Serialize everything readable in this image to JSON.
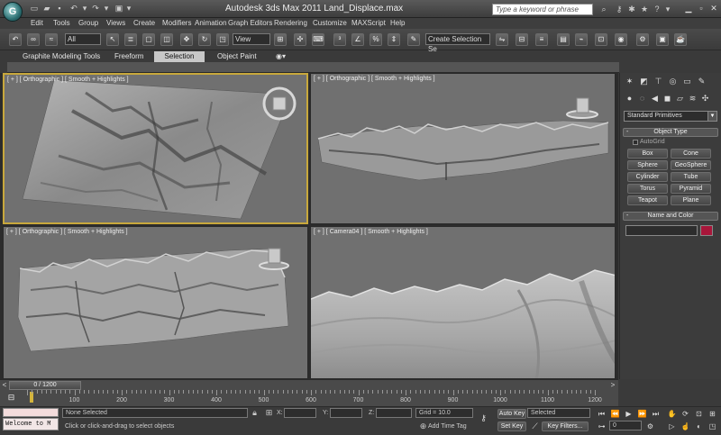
{
  "titlebar": {
    "app_title": "Autodesk 3ds Max  2011        Land_Displace.max",
    "search_placeholder": "Type a keyword or phrase",
    "logo_glyph": "G"
  },
  "menu": [
    "Edit",
    "Tools",
    "Group",
    "Views",
    "Create",
    "Modifiers",
    "Animation",
    "Graph Editors",
    "Rendering",
    "Customize",
    "MAXScript",
    "Help"
  ],
  "toolbar": {
    "filter_value": "All",
    "refcoord_value": "View",
    "selection_set_placeholder": "Create Selection Se"
  },
  "ribbon": {
    "tabs": [
      "Graphite Modeling Tools",
      "Freeform",
      "Selection",
      "Object Paint"
    ],
    "active_tab": "Selection"
  },
  "viewports": [
    {
      "label": "[ + ] [ Orthographic ] [ Smooth + Highlights ]",
      "active": true
    },
    {
      "label": "[ + ] [ Orthographic ] [ Smooth + Highlights ]",
      "active": false
    },
    {
      "label": "[ + ] [ Orthographic ] [ Smooth + Highlights ]",
      "active": false
    },
    {
      "label": "[ + ] [ Camera04 ] [ Smooth + Highlights ]",
      "active": false
    }
  ],
  "command_panel": {
    "category_dropdown": "Standard Primitives",
    "object_type_title": "Object Type",
    "autogrid_label": "AutoGrid",
    "primitives": [
      "Box",
      "Cone",
      "Sphere",
      "GeoSphere",
      "Cylinder",
      "Tube",
      "Torus",
      "Pyramid",
      "Teapot",
      "Plane"
    ],
    "name_color_title": "Name and Color",
    "object_color": "#a8163a"
  },
  "timeline": {
    "frame_display": "0 / 1200",
    "ruler_labels": [
      "100",
      "200",
      "300",
      "400",
      "500",
      "600",
      "700",
      "800",
      "900",
      "1000",
      "1100",
      "1200"
    ]
  },
  "statusbar": {
    "maxscript_text": "Welcome to M",
    "selection_status": "None Selected",
    "prompt": "Click or click-and-drag to select objects",
    "x_label": "X:",
    "y_label": "Y:",
    "z_label": "Z:",
    "grid": "Grid = 10.0",
    "add_time_tag": "Add Time Tag",
    "auto_key": "Auto Key",
    "set_key": "Set Key",
    "key_mode_value": "Selected",
    "key_filters": "Key Filters...",
    "current_frame": "0"
  }
}
